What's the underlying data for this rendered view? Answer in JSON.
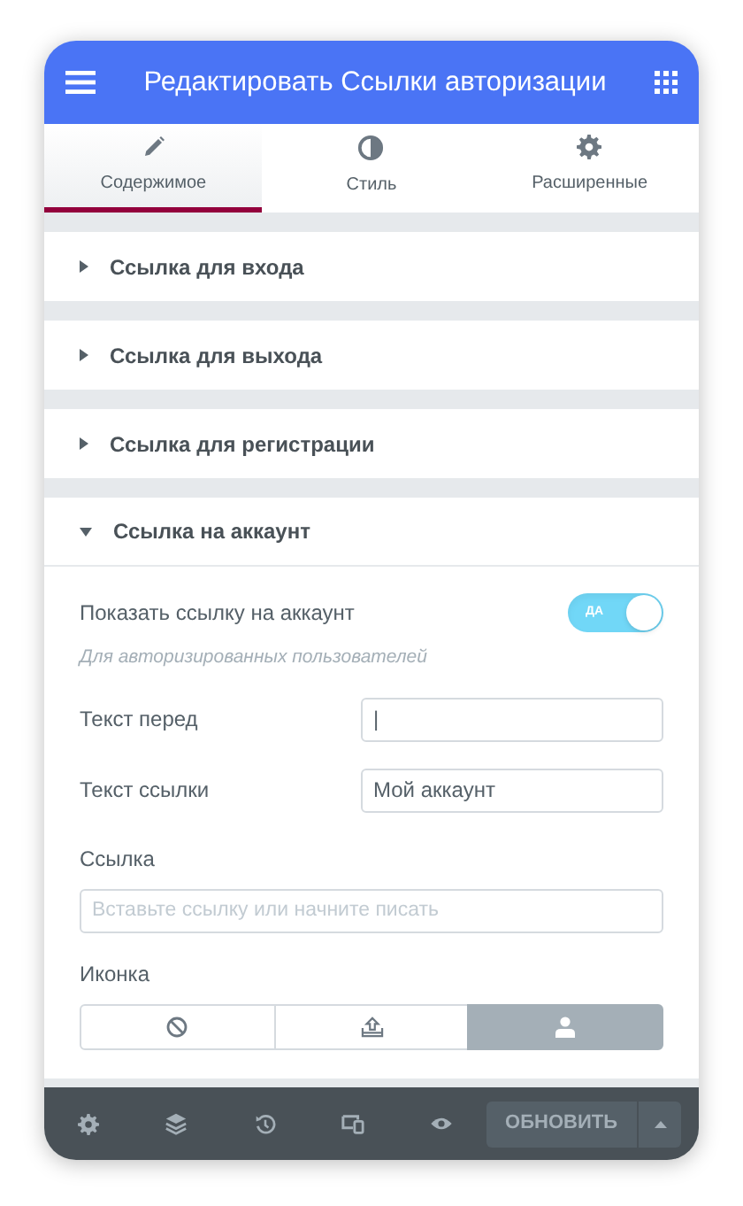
{
  "header": {
    "title": "Редактировать Ссылки авторизации"
  },
  "tabs": [
    {
      "label": "Содержимое",
      "selected": true
    },
    {
      "label": "Стиль",
      "selected": false
    },
    {
      "label": "Расширенные",
      "selected": false
    }
  ],
  "sections": [
    {
      "title": "Ссылка для входа",
      "expanded": false
    },
    {
      "title": "Ссылка для выхода",
      "expanded": false
    },
    {
      "title": "Ссылка для регистрации",
      "expanded": false
    },
    {
      "title": "Ссылка на аккаунт",
      "expanded": true,
      "controls": [
        {
          "kind": "switch",
          "label": "Показать ссылку на аккаунт",
          "on": true,
          "on_text": "ДА"
        },
        {
          "kind": "hint",
          "text": "Для авторизированных пользователей"
        },
        {
          "kind": "text",
          "label": "Текст перед",
          "value": "|"
        },
        {
          "kind": "text",
          "label": "Текст ссылки",
          "value": "Мой аккаунт"
        },
        {
          "kind": "stacked",
          "label": "Ссылка",
          "placeholder": "Вставьте ссылку или начните писать"
        },
        {
          "kind": "choice",
          "label": "Иконка",
          "options": [
            {
              "selected": false
            },
            {
              "selected": false
            },
            {
              "selected": true
            }
          ]
        }
      ]
    }
  ],
  "footer": {
    "update_button": "ОБНОВИТЬ"
  }
}
